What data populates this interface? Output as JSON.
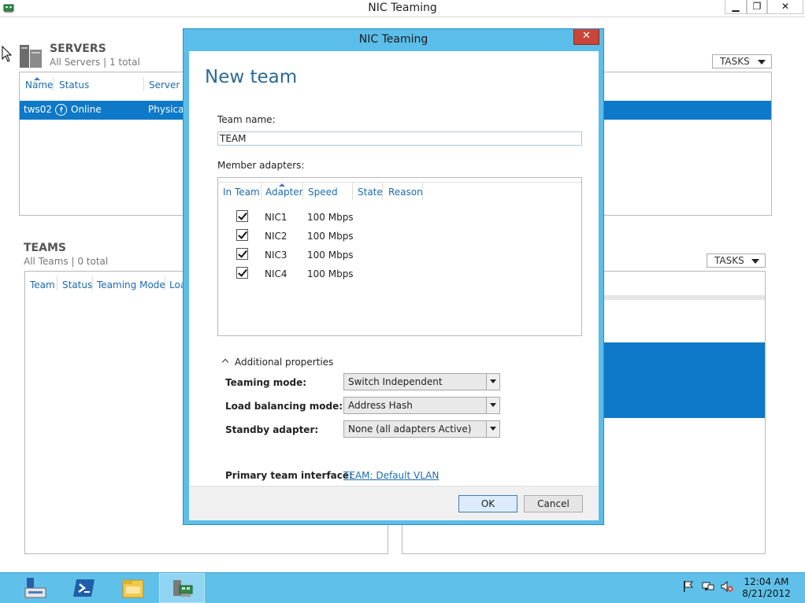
{
  "window": {
    "title": "NIC Teaming",
    "min_label": "▁",
    "max_label": "❐",
    "close_label": "✕"
  },
  "servers": {
    "title": "SERVERS",
    "subtitle": "All Servers | 1 total",
    "tasks_label": "TASKS",
    "columns": [
      "Name",
      "Status",
      "Server T"
    ],
    "rows": [
      {
        "name": "tws02",
        "status": "Online",
        "server_type": "Physical"
      }
    ]
  },
  "teams": {
    "title": "TEAMS",
    "subtitle": "All Teams | 0 total",
    "tasks_label": "TASKS",
    "columns": [
      "Team",
      "Status",
      "Teaming Mode",
      "Loa"
    ]
  },
  "dialog": {
    "title": "NIC Teaming",
    "close_label": "✕",
    "heading": "New team",
    "team_name_label": "Team name:",
    "team_name_value": "TEAM",
    "member_adapters_label": "Member adapters:",
    "adapter_columns": [
      "In Team",
      "Adapter",
      "Speed",
      "State",
      "Reason"
    ],
    "adapters": [
      {
        "name": "NIC1",
        "speed": "100 Mbps",
        "in_team": true
      },
      {
        "name": "NIC2",
        "speed": "100 Mbps",
        "in_team": true
      },
      {
        "name": "NIC3",
        "speed": "100 Mbps",
        "in_team": true
      },
      {
        "name": "NIC4",
        "speed": "100 Mbps",
        "in_team": true
      }
    ],
    "additional_properties_label": "Additional properties",
    "teaming_mode_label": "Teaming mode:",
    "teaming_mode_value": "Switch Independent",
    "load_balancing_label": "Load balancing mode:",
    "load_balancing_value": "Address Hash",
    "standby_label": "Standby adapter:",
    "standby_value": "None (all adapters Active)",
    "primary_interface_label": "Primary team interface:",
    "primary_interface_link": "TEAM: Default VLAN",
    "ok_label": "OK",
    "cancel_label": "Cancel"
  },
  "taskbar": {
    "apps": [
      "server-manager-icon",
      "powershell-icon",
      "file-explorer-icon",
      "nic-teaming-icon"
    ],
    "time": "12:04 AM",
    "date": "8/21/2012"
  }
}
